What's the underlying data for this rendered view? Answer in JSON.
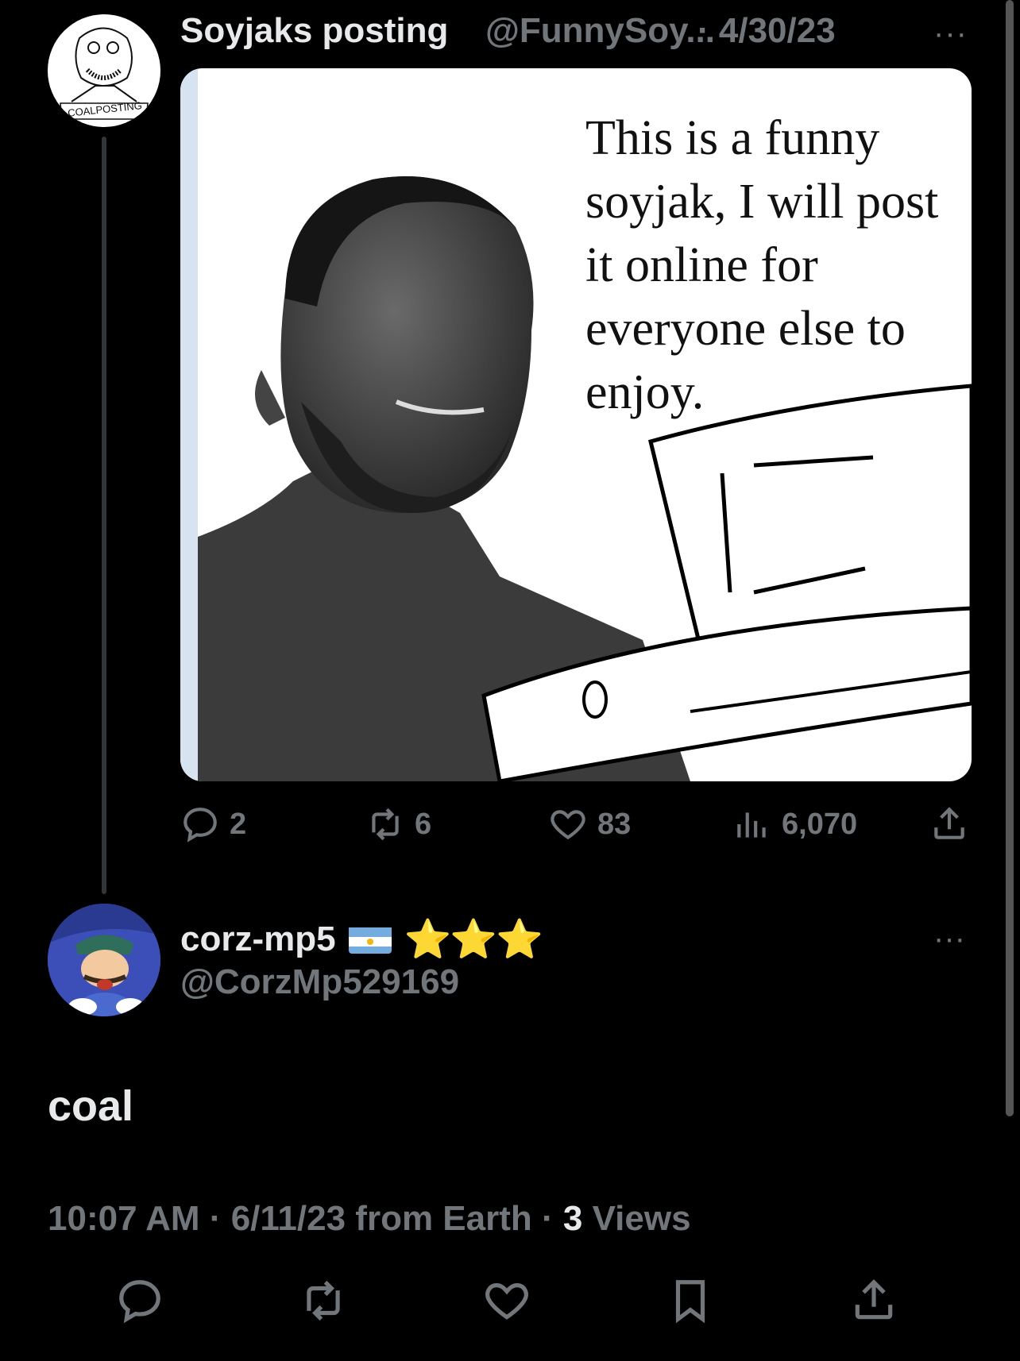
{
  "parent_tweet": {
    "display_name": "Soyjaks posting",
    "handle": "@FunnySoy...",
    "date": "· 4/30/23",
    "more": "···",
    "avatar_caption": "COALPOSTING",
    "media_text": "This is a funny soyjak, I will post it online for everyone else to enjoy.",
    "actions": {
      "replies": "2",
      "reposts": "6",
      "likes": "83",
      "views": "6,070"
    }
  },
  "reply_tweet": {
    "display_name": "corz-mp5",
    "flag_icon": "argentina-flag-icon",
    "stars": "⭐⭐⭐",
    "handle": "@CorzMp529169",
    "more": "···",
    "body": "coal",
    "meta": {
      "time": "10:07 AM",
      "date": "6/11/23",
      "source": "from Earth",
      "views_count": "3",
      "views_label": "Views"
    }
  },
  "colors": {
    "background": "#000000",
    "text_primary": "#e7e9ea",
    "text_secondary": "#71767b",
    "divider": "#333639"
  }
}
